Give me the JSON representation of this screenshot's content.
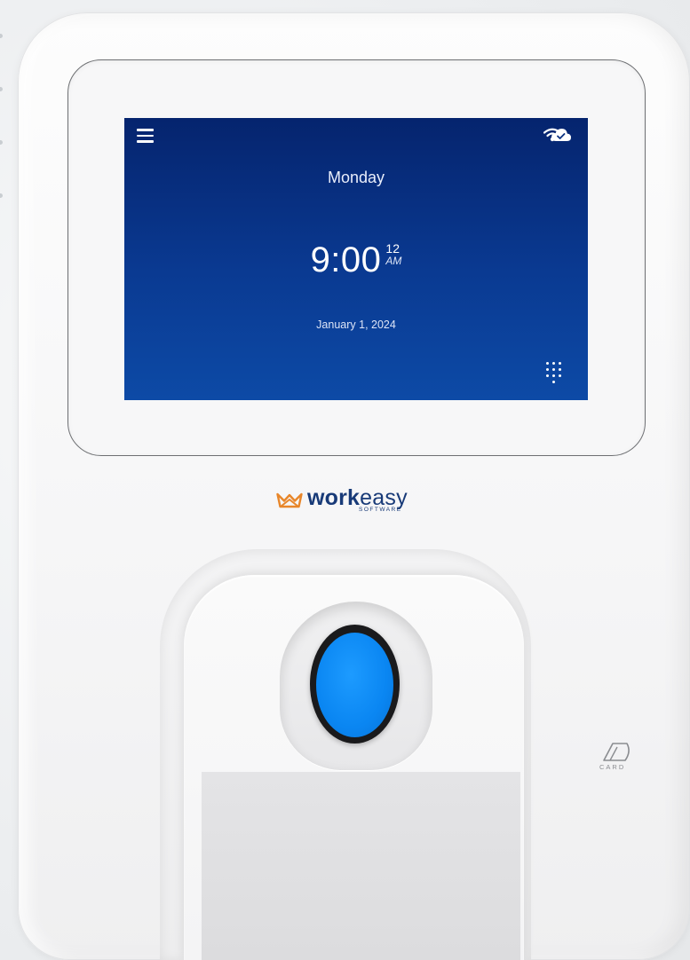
{
  "screen": {
    "day": "Monday",
    "time": "9:00",
    "seconds": "12",
    "ampm": "AM",
    "date": "January 1, 2024",
    "icons": {
      "menu": "menu-icon",
      "wifi": "wifi-icon",
      "cloud": "cloud-icon",
      "keypad": "keypad-icon"
    }
  },
  "brand": {
    "name_bold": "work",
    "name_light": "easy",
    "sub": "SOFTWARE",
    "color": "#183a78",
    "accent": "#e8862a"
  },
  "card_reader": {
    "label": "CARD"
  },
  "colors": {
    "screen_top": "#05246e",
    "screen_bottom": "#0d4aa6",
    "sensor": "#0a86f2"
  }
}
